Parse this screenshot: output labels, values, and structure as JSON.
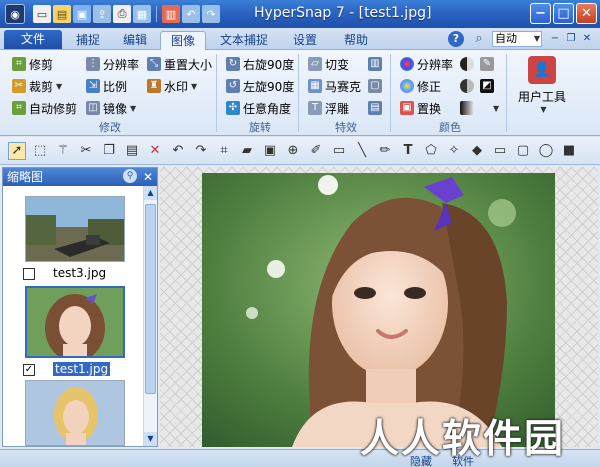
{
  "window": {
    "title": "HyperSnap 7 - [test1.jpg]",
    "minimize": "−",
    "maximize": "□",
    "close": "✕"
  },
  "menu": {
    "file": "文件",
    "tabs": [
      "捕捉",
      "编辑",
      "图像",
      "文本捕捉",
      "设置",
      "帮助"
    ],
    "active_tab": "图像",
    "help": "?",
    "auto_select": "自动"
  },
  "ribbon": {
    "modify": {
      "label": "修改",
      "items": [
        "修剪",
        "分辨率",
        "重置大小",
        "裁剪",
        "比例",
        "水印",
        "自动修剪",
        "镜像"
      ]
    },
    "rotate": {
      "label": "旋转",
      "items": [
        "右旋90度",
        "左旋90度",
        "任意角度"
      ]
    },
    "effects": {
      "label": "特效",
      "items": [
        "切变",
        "马赛克",
        "浮雕"
      ]
    },
    "color": {
      "label": "颜色",
      "items": [
        "分辨率",
        "修正",
        "置换"
      ]
    },
    "user_tools": "用户工具"
  },
  "thumbnails": {
    "title": "缩略图",
    "items": [
      {
        "name": "test3.jpg",
        "checked": false
      },
      {
        "name": "test1.jpg",
        "checked": true
      }
    ]
  },
  "status": {
    "a": "隐藏",
    "b": "软件"
  },
  "watermark": "人人软件园"
}
